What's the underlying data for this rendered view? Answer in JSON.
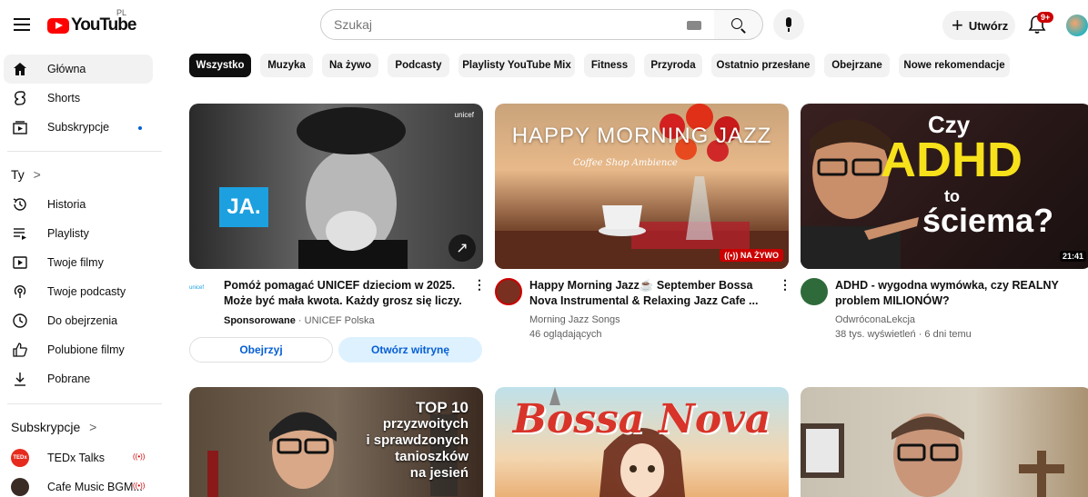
{
  "header": {
    "logo_text": "YouTube",
    "country": "PL",
    "search_placeholder": "Szukaj",
    "create_label": "Utwórz",
    "notifications_count": "9+"
  },
  "sidebar": {
    "main": [
      {
        "label": "Główna",
        "icon": "home-icon"
      },
      {
        "label": "Shorts",
        "icon": "shorts-icon"
      },
      {
        "label": "Subskrypcje",
        "icon": "subscriptions-icon"
      }
    ],
    "you_heading": "Ty",
    "you_chevron": ">",
    "you": [
      {
        "label": "Historia",
        "icon": "history-icon"
      },
      {
        "label": "Playlisty",
        "icon": "playlist-icon"
      },
      {
        "label": "Twoje filmy",
        "icon": "your-videos-icon"
      },
      {
        "label": "Twoje podcasty",
        "icon": "podcast-icon"
      },
      {
        "label": "Do obejrzenia",
        "icon": "watch-later-icon"
      },
      {
        "label": "Polubione filmy",
        "icon": "like-icon"
      },
      {
        "label": "Pobrane",
        "icon": "download-icon"
      }
    ],
    "subs_heading": "Subskrypcje",
    "subs_chevron": ">",
    "subs": [
      {
        "label": "TEDx Talks"
      },
      {
        "label": "Cafe Music BGM..."
      }
    ]
  },
  "chips": [
    "Wszystko",
    "Muzyka",
    "Na żywo",
    "Podcasty",
    "Playlisty YouTube Mix",
    "Fitness",
    "Przyroda",
    "Ostatnio przesłane",
    "Obejrzane",
    "Nowe rekomendacje"
  ],
  "videos": [
    {
      "title1": "Pomóż pomagać UNICEF dzieciom w 2025.",
      "title2": "Może być mała kwota. Każdy grosz się liczy.",
      "sponsored": "Sponsorowane",
      "channel": " · UNICEF Polska",
      "thumb_text": "JA.",
      "brand": "unicef",
      "btn_watch": "Obejrzyj",
      "btn_site": "Otwórz witrynę"
    },
    {
      "title1": "Happy Morning Jazz☕ September Bossa",
      "title2": "Nova Instrumental & Relaxing Jazz Cafe ...",
      "channel": "Morning Jazz Songs",
      "stats": "46 oglądających",
      "thumb_text": "HAPPY MORNING JAZZ",
      "thumb_script": "Coffee Shop Ambience",
      "live_label": "NA ŻYWO"
    },
    {
      "title1": "ADHD - wygodna wymówka, czy REALNY",
      "title2": "problem MILIONÓW?",
      "channel": "OdwróconaLekcja",
      "stats": "38 tys. wyświetleń · 6 dni temu",
      "thumb_line1": "Czy",
      "thumb_line2": "ADHD",
      "thumb_line3": "to",
      "thumb_line4": "ściema?",
      "duration": "21:41"
    },
    {
      "thumb_lines": [
        "TOP 10",
        "przyzwoitych",
        "i sprawdzonych",
        "tanioszków",
        "na jesień"
      ]
    },
    {
      "thumb_text": "Bossa Nova"
    },
    {}
  ]
}
